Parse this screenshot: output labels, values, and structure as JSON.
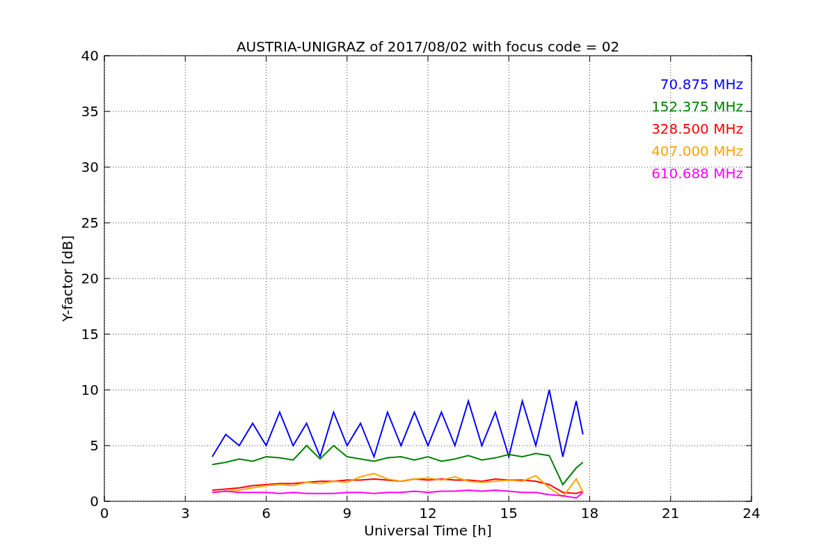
{
  "figure": {
    "chart_data": {
      "type": "line",
      "title": "AUSTRIA-UNIGRAZ of 2017/08/02 with focus code = 02",
      "xlabel": "Universal Time [h]",
      "ylabel": "Y-factor [dB]",
      "xlim": [
        0,
        24
      ],
      "ylim": [
        0,
        40
      ],
      "xticks": [
        0,
        3,
        6,
        9,
        12,
        15,
        18,
        21,
        24
      ],
      "yticks": [
        0,
        5,
        10,
        15,
        20,
        25,
        30,
        35,
        40
      ],
      "grid": true,
      "x": [
        4,
        4.5,
        5,
        5.5,
        6,
        6.5,
        7,
        7.5,
        8,
        8.5,
        9,
        9.5,
        10,
        10.5,
        11,
        11.5,
        12,
        12.5,
        13,
        13.5,
        14,
        14.5,
        15,
        15.5,
        16,
        16.5,
        17,
        17.5,
        17.75
      ],
      "series": [
        {
          "name": "70.875 MHz",
          "color": "#0000ff",
          "values": [
            4,
            6,
            5,
            7,
            5,
            8,
            5,
            7,
            4,
            8,
            5,
            7,
            4,
            8,
            5,
            8,
            5,
            8,
            5,
            9,
            5,
            8,
            4,
            9,
            5,
            10,
            4,
            9,
            6
          ]
        },
        {
          "name": "152.375 MHz",
          "color": "#008000",
          "values": [
            3.3,
            3.5,
            3.8,
            3.6,
            4,
            3.9,
            3.7,
            5,
            3.8,
            5,
            4,
            3.8,
            3.6,
            3.9,
            4,
            3.7,
            4,
            3.6,
            3.8,
            4.1,
            3.7,
            3.9,
            4.2,
            4,
            4.3,
            4.1,
            1.5,
            3,
            3.5
          ]
        },
        {
          "name": "328.500 MHz",
          "color": "#ff0000",
          "values": [
            1,
            1.1,
            1.2,
            1.4,
            1.5,
            1.6,
            1.6,
            1.7,
            1.8,
            1.8,
            1.9,
            1.9,
            2,
            1.9,
            1.8,
            2,
            1.9,
            2,
            1.9,
            1.9,
            1.8,
            2,
            1.9,
            1.9,
            1.8,
            1.5,
            0.8,
            0.7,
            0.9
          ]
        },
        {
          "name": "407.000 MHz",
          "color": "#ffa500",
          "values": [
            0.8,
            0.9,
            1,
            1.2,
            1.4,
            1.5,
            1.4,
            1.7,
            1.6,
            1.8,
            1.7,
            2.2,
            2.5,
            2,
            1.8,
            2,
            2.1,
            1.9,
            2.2,
            1.8,
            1.7,
            1.8,
            1.9,
            1.8,
            2.3,
            1.2,
            0.4,
            2,
            0.8
          ]
        },
        {
          "name": "610.688 MHz",
          "color": "#ff00ff",
          "values": [
            0.8,
            0.9,
            0.8,
            0.8,
            0.8,
            0.7,
            0.8,
            0.7,
            0.7,
            0.7,
            0.8,
            0.8,
            0.7,
            0.8,
            0.8,
            0.9,
            0.8,
            0.9,
            0.9,
            1,
            0.9,
            1,
            0.9,
            0.8,
            0.8,
            0.6,
            0.5,
            0.3,
            0.8
          ]
        }
      ]
    }
  }
}
